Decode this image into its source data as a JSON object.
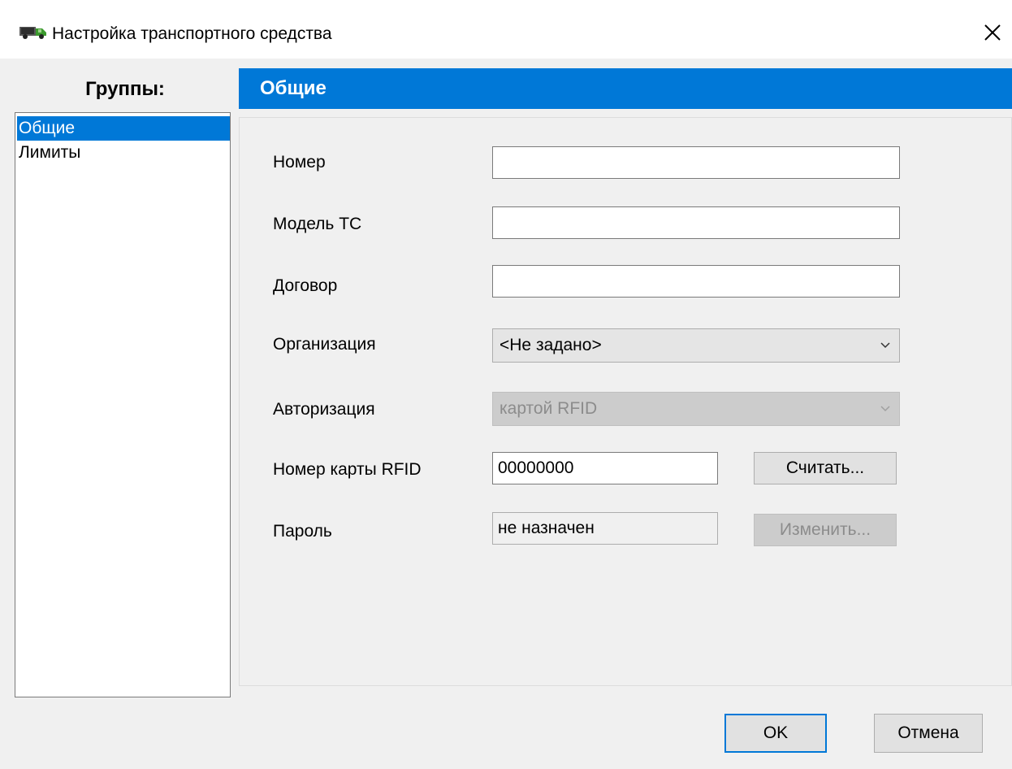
{
  "window": {
    "title": "Настройка транспортного средства",
    "icon": "truck-icon"
  },
  "sidebar": {
    "header": "Группы:",
    "items": [
      {
        "label": "Общие",
        "selected": true
      },
      {
        "label": "Лимиты",
        "selected": false
      }
    ]
  },
  "main": {
    "section_title": "Общие",
    "fields": {
      "number": {
        "label": "Номер",
        "value": ""
      },
      "model": {
        "label": "Модель ТС",
        "value": ""
      },
      "contract": {
        "label": "Договор",
        "value": ""
      },
      "organization": {
        "label": "Организация",
        "selected": "<Не задано>"
      },
      "authorization": {
        "label": "Авторизация",
        "selected": "картой RFID",
        "disabled": true
      },
      "rfid": {
        "label": "Номер карты RFID",
        "value": "00000000",
        "button": "Считать..."
      },
      "password": {
        "label": "Пароль",
        "value": "не назначен",
        "button": "Изменить...",
        "button_disabled": true
      }
    }
  },
  "footer": {
    "ok_label": "OK",
    "cancel_label": "Отмена"
  },
  "colors": {
    "accent": "#0078d7",
    "window_bg": "#f0f0f0"
  }
}
